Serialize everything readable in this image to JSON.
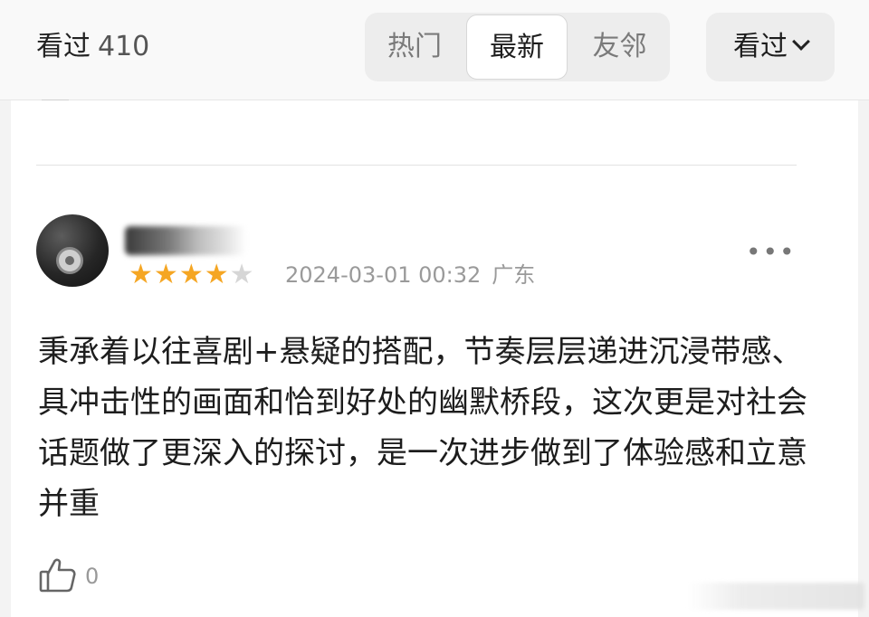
{
  "header": {
    "watched_label": "看过",
    "watched_count": "410",
    "tabs": [
      {
        "label": "热门",
        "active": false
      },
      {
        "label": "最新",
        "active": true
      },
      {
        "label": "友邻",
        "active": false
      }
    ],
    "filter": {
      "label": "看过",
      "icon": "chevron-down-icon"
    }
  },
  "review": {
    "rating": {
      "value": 4,
      "max": 5,
      "color": "#f5a623"
    },
    "date": "2024-03-01 00:32",
    "location": "广东",
    "more_icon": "more-horizontal-icon",
    "text": "秉承着以往喜剧+悬疑的搭配，节奏层层递进沉浸带感、具冲击性的画面和恰到好处的幽默桥段，这次更是对社会话题做了更深入的探讨，是一次进步做到了体验感和立意并重",
    "likes": {
      "count": "0",
      "icon": "thumbs-up-icon"
    }
  },
  "colors": {
    "star_full": "#f5a623",
    "star_empty": "#d6d6d6",
    "meta_text": "#9a9a9a"
  }
}
